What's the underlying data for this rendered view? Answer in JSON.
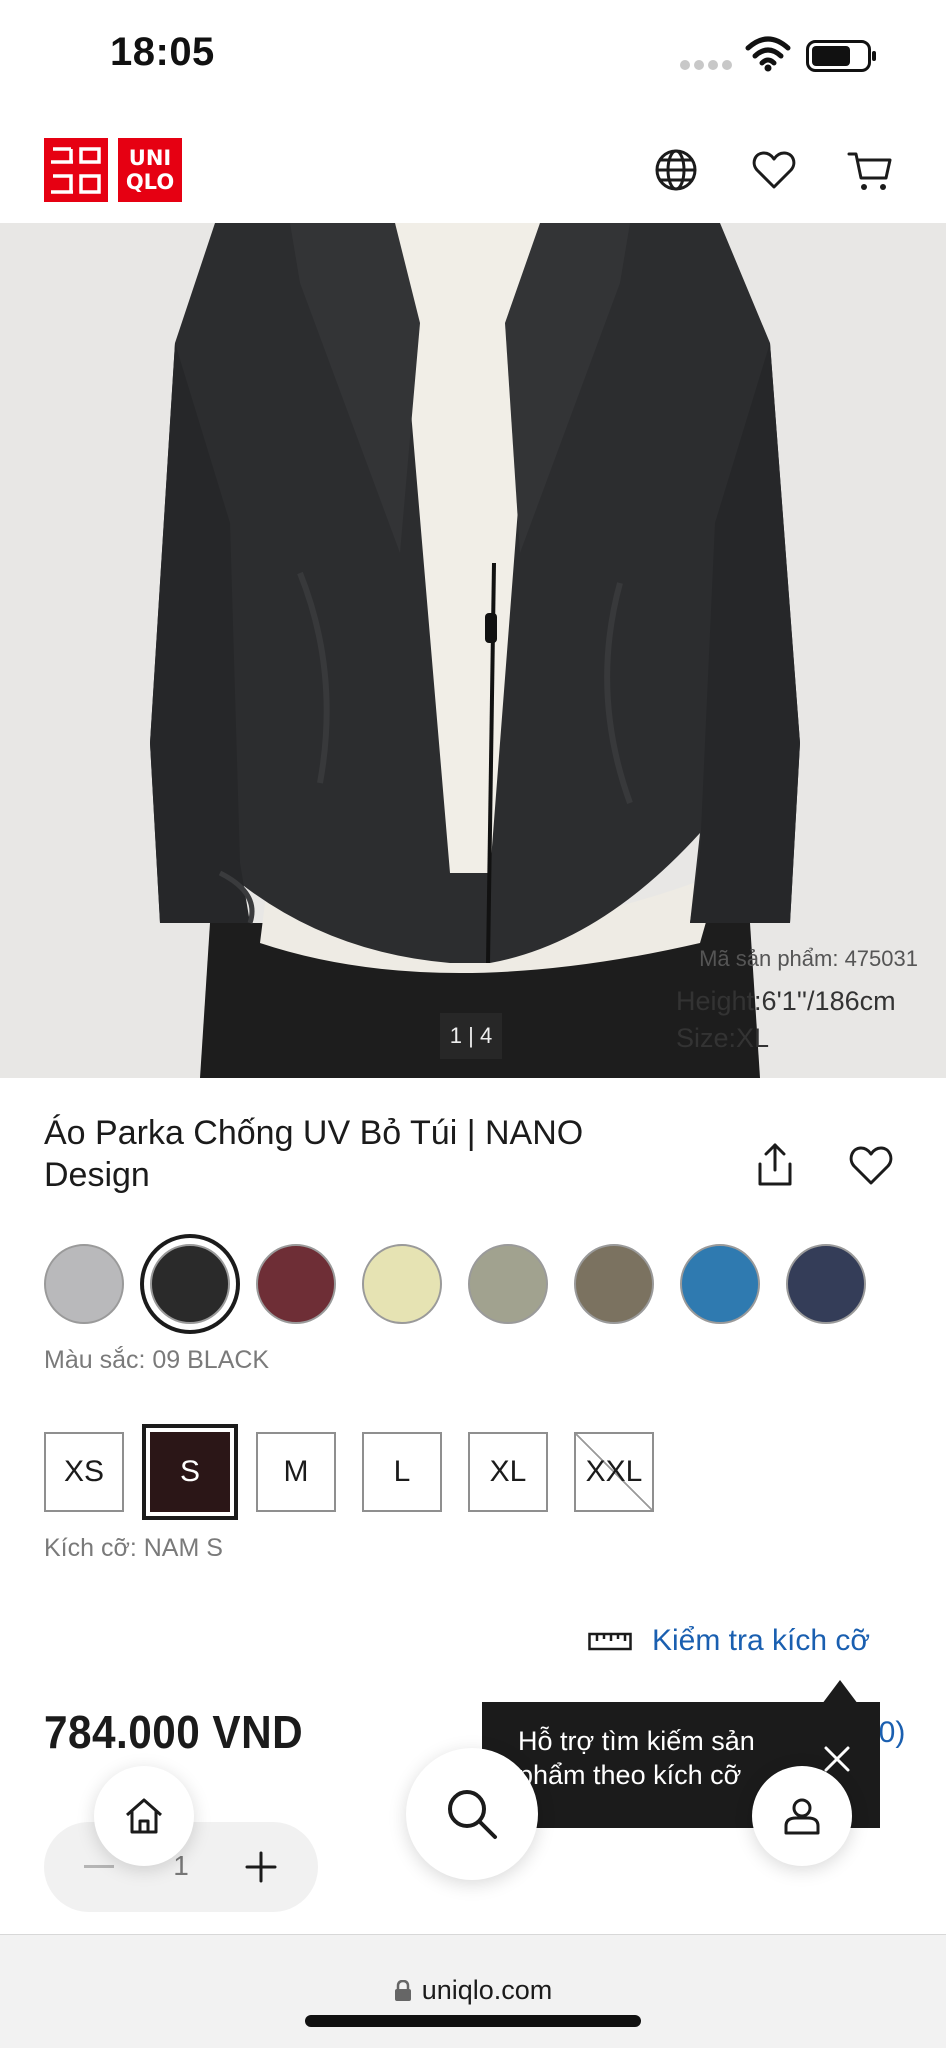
{
  "status_bar": {
    "time": "18:05",
    "icons": [
      "signal-dots-icon",
      "wifi-icon",
      "battery-icon"
    ]
  },
  "header": {
    "logo_top": "ユニ",
    "logo_bottom": "クロ",
    "logo_brand_top": "UNI",
    "logo_brand_bottom": "QLO",
    "icons": [
      "globe-icon",
      "heart-icon",
      "cart-icon"
    ],
    "brand_color": "#e60012"
  },
  "hero": {
    "product_code": "Mã sản phẩm: 475031",
    "model_height": "Height:6'1''/186cm",
    "model_size": "Size:XL",
    "counter": "1 | 4"
  },
  "product": {
    "title": "Áo Parka Chống UV Bỏ Túi | NANO Design",
    "color_label": "Màu sắc: 09 BLACK",
    "colors": [
      {
        "name": "light-gray",
        "hex": "#b9b9bb",
        "selected": false
      },
      {
        "name": "black",
        "hex": "#2a2a2a",
        "selected": true
      },
      {
        "name": "wine",
        "hex": "#6e2e36",
        "selected": false
      },
      {
        "name": "cream-yellow",
        "hex": "#e6e3b3",
        "selected": false
      },
      {
        "name": "sage",
        "hex": "#a1a28f",
        "selected": false
      },
      {
        "name": "olive-brown",
        "hex": "#7b7260",
        "selected": false
      },
      {
        "name": "blue",
        "hex": "#2f7ab0",
        "selected": false
      },
      {
        "name": "navy",
        "hex": "#343d58",
        "selected": false
      }
    ],
    "sizes": [
      {
        "label": "XS",
        "selected": false,
        "available": true
      },
      {
        "label": "S",
        "selected": true,
        "available": true
      },
      {
        "label": "M",
        "selected": false,
        "available": true
      },
      {
        "label": "L",
        "selected": false,
        "available": true
      },
      {
        "label": "XL",
        "selected": false,
        "available": true
      },
      {
        "label": "XXL",
        "selected": false,
        "available": false
      }
    ],
    "size_label": "Kích cỡ: NAM S",
    "size_check_label": "Kiểm tra kích cỡ",
    "price": "784.000 VND",
    "rating_stars": "★★★★★",
    "review_count": "(20)",
    "quantity": "1"
  },
  "tooltip": {
    "text": "Hỗ trợ tìm kiếm sản phẩm theo kích cỡ"
  },
  "fabs": [
    "home-icon",
    "search-icon",
    "user-icon"
  ],
  "browser": {
    "url": "uniqlo.com"
  },
  "colors": {
    "link_blue": "#1a5fb0",
    "selected_size_bg": "#2b1617"
  }
}
